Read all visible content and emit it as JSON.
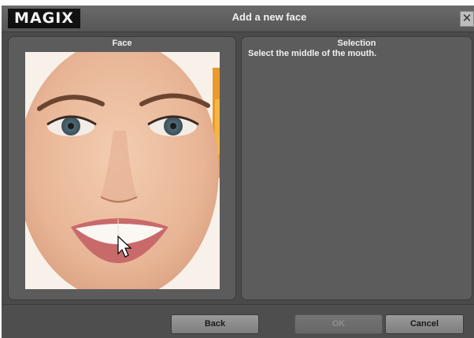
{
  "dialog": {
    "logo": "MAGIX",
    "title": "Add a new face",
    "close_icon": "close-icon"
  },
  "face_panel": {
    "header": "Face"
  },
  "selection_panel": {
    "header": "Selection",
    "instruction": "Select the middle of the mouth."
  },
  "buttons": {
    "back": "Back",
    "ok": "OK",
    "cancel": "Cancel"
  },
  "colors": {
    "panel": "#5c5c5c",
    "dialog": "#4a4a4a",
    "accent_orange": "#f0a020"
  }
}
